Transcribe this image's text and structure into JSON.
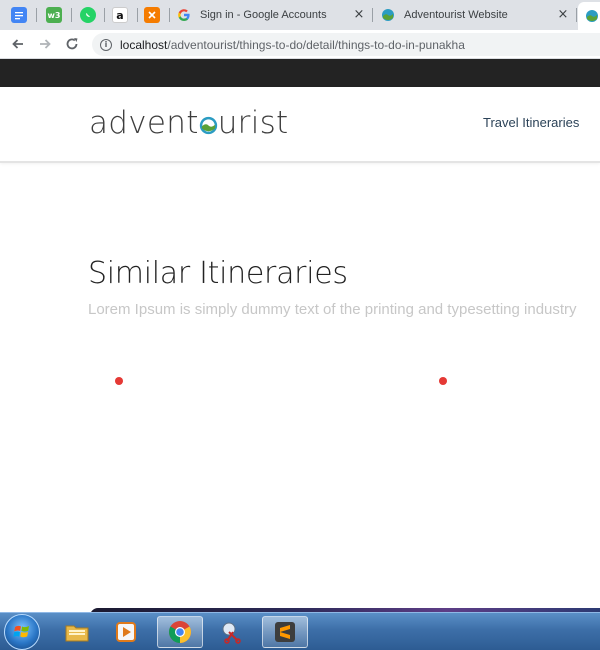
{
  "browser": {
    "pinned_tabs": [
      {
        "name": "google-docs-tab",
        "glyph": "",
        "color": "#4285f4"
      },
      {
        "name": "w3schools-tab",
        "glyph": "w3",
        "color": "#4caf50"
      },
      {
        "name": "whatsapp-tab",
        "glyph": "",
        "color": "#25d366"
      },
      {
        "name": "amazon-tab",
        "glyph": "a",
        "color": "#ffffff"
      },
      {
        "name": "xampp-tab",
        "glyph": "",
        "color": "#f57c00"
      }
    ],
    "tabs": [
      {
        "title": "Sign in - Google Accounts",
        "close": "×",
        "active": false
      },
      {
        "title": "Adventourist Website",
        "close": "×",
        "active": false
      }
    ],
    "address": {
      "host": "localhost",
      "path": "/adventourist/things-to-do/detail/things-to-do-in-punakha"
    }
  },
  "site": {
    "logo": {
      "pre": "ad",
      "post": "vent",
      "tail": "urist"
    },
    "nav": {
      "travel_itineraries": "Travel Itineraries"
    }
  },
  "section": {
    "title": "Similar Itineraries",
    "subtitle": "Lorem Ipsum is simply dummy text of the printing and typesetting industry"
  },
  "colors": {
    "accent_red": "#e53935",
    "logo_teal": "#2b9cc2",
    "logo_green": "#5aa136",
    "nav_text": "#2c4358"
  },
  "taskbar": {
    "items": [
      "start-button",
      "file-explorer",
      "media-player",
      "chrome",
      "snipping-tool",
      "sublime-text"
    ]
  }
}
